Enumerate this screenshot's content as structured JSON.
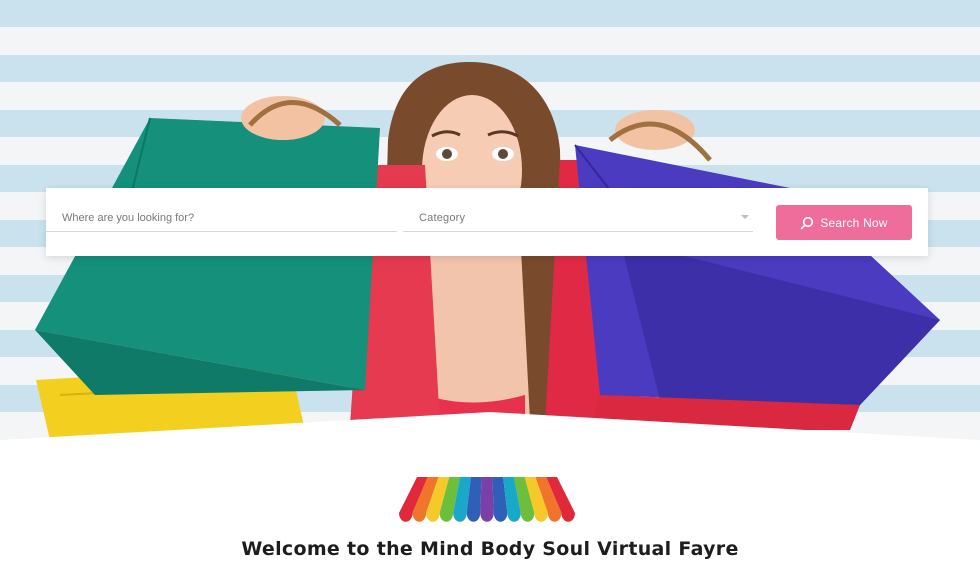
{
  "search": {
    "location_placeholder": "Where are you looking for?",
    "category_value": "Category",
    "button_label": "Search Now"
  },
  "welcome": {
    "title": "Welcome to the Mind Body Soul Virtual Fayre"
  },
  "colors": {
    "accent": "#ee6d9b",
    "stripe_blue": "#c9e2ee",
    "bag_green": "#12907a",
    "bag_purple": "#4b3bc0",
    "bag_yellow": "#f3cf1f",
    "bag_red": "#e8314c",
    "awning": [
      "#e02a3c",
      "#f0742a",
      "#f5c92a",
      "#6bbf3a",
      "#1aa8c9",
      "#2f5fb8",
      "#7b3fa8",
      "#2f5fb8",
      "#1aa8c9",
      "#6bbf3a",
      "#f5c92a",
      "#f0742a",
      "#e02a3c"
    ]
  },
  "icons": {
    "search": "search-icon",
    "chevron": "chevron-down-icon"
  }
}
